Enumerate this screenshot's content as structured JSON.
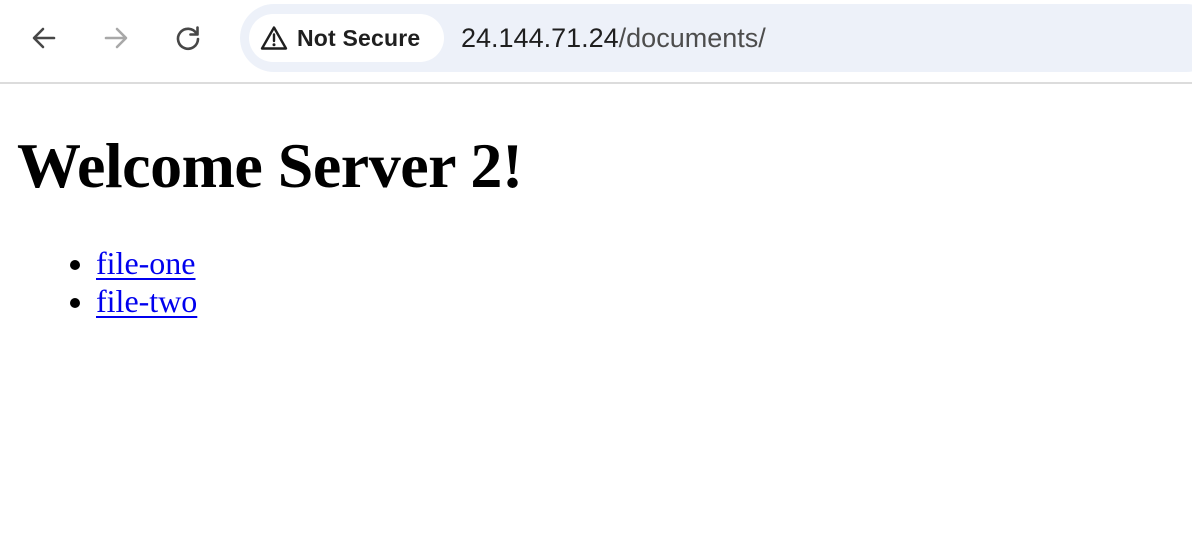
{
  "browser": {
    "back_icon": "arrow-left-icon",
    "forward_icon": "arrow-right-icon",
    "reload_icon": "reload-icon",
    "security_icon": "warning-triangle-icon",
    "security_label": "Not Secure",
    "url_host": "24.144.71.24",
    "url_path": "/documents/"
  },
  "page": {
    "heading": "Welcome Server 2!",
    "links": [
      {
        "label": "file-one"
      },
      {
        "label": "file-two"
      }
    ]
  },
  "colors": {
    "link": "#0000ee",
    "omnibox_bg": "#edf1f9",
    "toolbar_border": "#dcdcdc"
  }
}
